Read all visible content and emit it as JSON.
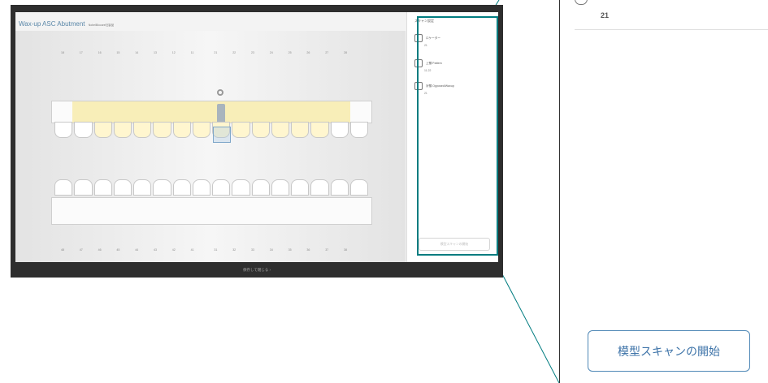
{
  "app": {
    "title": "Wax-up ASC Abutment",
    "title_sub": "NobelBiocare社製品",
    "hint": "スキャンに含める構造を選択してください。",
    "bottom_label": "保存して閉じる ›"
  },
  "upper_numbers": [
    "18",
    "17",
    "16",
    "15",
    "14",
    "13",
    "12",
    "11",
    "21",
    "22",
    "23",
    "24",
    "25",
    "26",
    "27",
    "28"
  ],
  "lower_numbers": [
    "48",
    "47",
    "46",
    "45",
    "44",
    "43",
    "42",
    "41",
    "31",
    "32",
    "33",
    "34",
    "35",
    "36",
    "37",
    "38"
  ],
  "side_panel": {
    "heading": "スキャン設定",
    "items": [
      {
        "label": "ロケーター",
        "value": "21",
        "icon": "tooth-icon"
      },
      {
        "label": "上顎 Pattern",
        "value": "11-22",
        "icon": "upper-jaw-icon"
      },
      {
        "label": "対顎 Opposed/Waxup",
        "value": "21",
        "icon": "opposing-model-icon"
      }
    ],
    "button_label": "模型スキャンの開始"
  },
  "zoom": {
    "icon": "lower-jaw-icon",
    "value": "21",
    "button_label": "模型スキャンの開始"
  },
  "colors": {
    "accent": "#007c80",
    "button_text": "#3d73a8",
    "highlight_yellow": "#f8eeb8"
  }
}
